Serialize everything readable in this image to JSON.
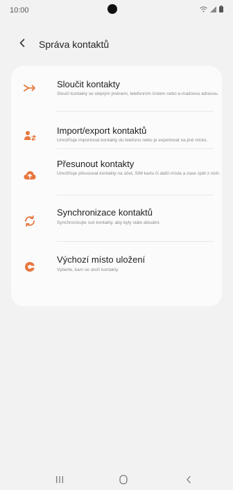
{
  "status_bar": {
    "time": "10:00"
  },
  "header": {
    "title": "Správa kontaktů"
  },
  "accent_color": "#e8773f",
  "items": [
    {
      "icon": "merge-icon",
      "title": "Sloučit kontakty",
      "subtitle": "Sloučí kontakty se stejným jménem, telefonním číslem nebo e-mailovou adresou."
    },
    {
      "icon": "import-export-icon",
      "title": "Import/export kontaktů",
      "subtitle": "Umožňuje importovat kontakty do telefonu nebo je exportovat na jiné místo."
    },
    {
      "icon": "cloud-upload-icon",
      "title": "Přesunout kontakty",
      "subtitle": "Umožňuje přesouvat kontakty na účet, SIM kartu či další místa a zase zpět z nich."
    },
    {
      "icon": "sync-icon",
      "title": "Synchronizace kontaktů",
      "subtitle": "Synchronizujte své kontakty, aby byly stále aktuální."
    },
    {
      "icon": "storage-location-icon",
      "title": "Výchozí místo uložení",
      "subtitle": "Vyberte, kam se uloží kontakty."
    }
  ],
  "nav_bar": {
    "recents": "recents-icon",
    "home": "home-icon",
    "back": "back-icon"
  }
}
